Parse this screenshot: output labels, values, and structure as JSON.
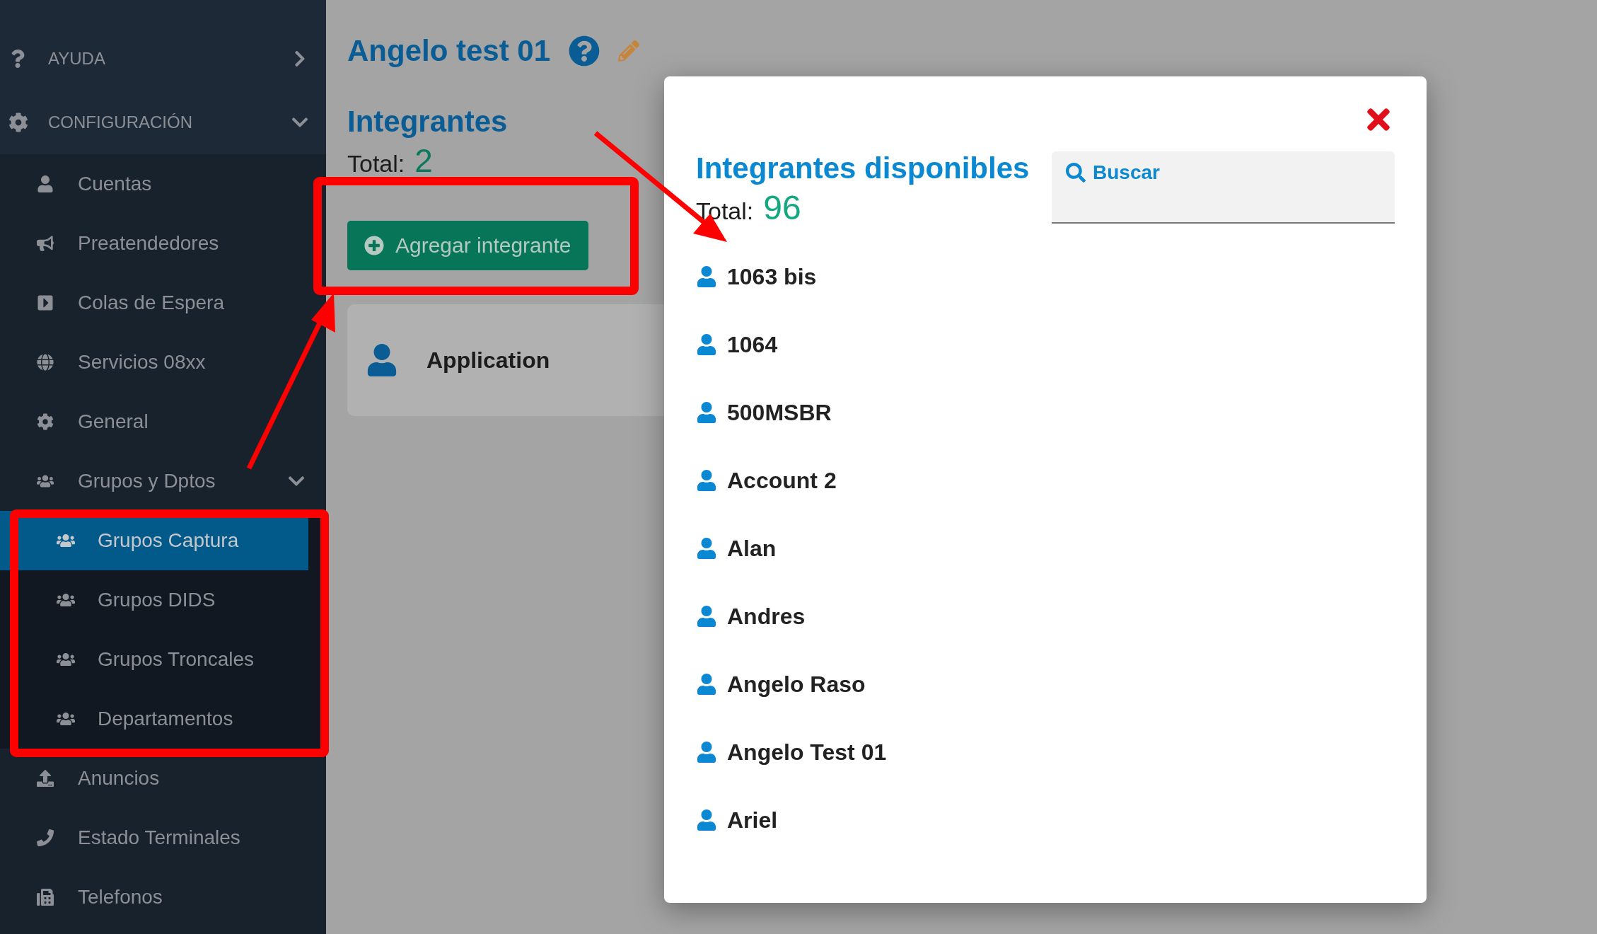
{
  "sidebar": {
    "sections": [
      {
        "label": "AYUDA",
        "kind": "help",
        "expanded": false
      },
      {
        "label": "CONFIGURACIÓN",
        "kind": "gear",
        "expanded": true,
        "children": [
          {
            "label": "Cuentas",
            "kind": "user",
            "selected": false
          },
          {
            "label": "Preatendedores",
            "kind": "megaphone",
            "selected": false
          },
          {
            "label": "Colas de Espera",
            "kind": "play",
            "selected": false
          },
          {
            "label": "Servicios 08xx",
            "kind": "globe",
            "selected": false
          },
          {
            "label": "General",
            "kind": "gear",
            "selected": false
          },
          {
            "label": "Grupos y Dptos",
            "kind": "users",
            "selected": false,
            "expanded": true,
            "children": [
              {
                "label": "Grupos Captura",
                "kind": "users",
                "selected": true
              },
              {
                "label": "Grupos DIDS",
                "kind": "users",
                "selected": false
              },
              {
                "label": "Grupos Troncales",
                "kind": "users",
                "selected": false
              },
              {
                "label": "Departamentos",
                "kind": "users",
                "selected": false
              }
            ]
          },
          {
            "label": "Anuncios",
            "kind": "upload",
            "selected": false
          },
          {
            "label": "Estado Terminales",
            "kind": "phone",
            "selected": false
          },
          {
            "label": "Telefonos",
            "kind": "telephone",
            "selected": false
          }
        ]
      }
    ]
  },
  "page": {
    "title": "Angelo test 01",
    "section_title": "Integrantes",
    "total_label": "Total:",
    "total": "2",
    "add_button": "Agregar integrante",
    "members": [
      {
        "name": "Application"
      }
    ]
  },
  "modal": {
    "title": "Integrantes disponibles",
    "total_label": "Total:",
    "total": "96",
    "search": {
      "placeholder": "Buscar"
    },
    "items": [
      "1063 bis",
      "1064",
      "500MSBR",
      "Account 2",
      "Alan",
      "Andres",
      "Angelo Raso",
      "Angelo Test 01",
      "Ariel"
    ]
  }
}
